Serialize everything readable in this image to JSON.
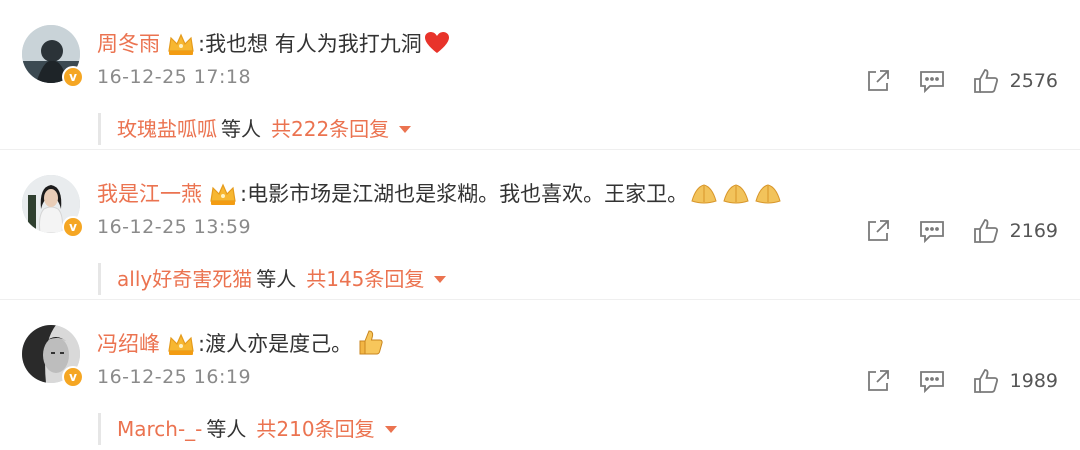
{
  "comments": [
    {
      "user": "周冬雨",
      "text": ":我也想 有人为我打九洞",
      "emoji": "heart-icon",
      "time": "16-12-25 17:18",
      "likes": "2576",
      "reply": {
        "first": "玫瑰盐呱呱",
        "mid": "等人",
        "total": "共222条回复"
      }
    },
    {
      "user": "我是江一燕",
      "text": ":电影市场是江湖也是浆糊。我也喜欢。王家卫。",
      "emoji": "pray-icon",
      "time": "16-12-25 13:59",
      "likes": "2169",
      "reply": {
        "first": "ally好奇害死猫",
        "mid": "等人",
        "total": "共145条回复"
      }
    },
    {
      "user": "冯绍峰",
      "text": ":渡人亦是度己。",
      "emoji": "thumbs-up-icon",
      "time": "16-12-25 16:19",
      "likes": "1989",
      "reply": {
        "first": "March-_-",
        "mid": "等人",
        "total": "共210条回复"
      }
    }
  ],
  "colors": {
    "username": "#eb7350",
    "text": "#333333",
    "meta": "#8a8a8a",
    "badge": "#f5a623"
  }
}
